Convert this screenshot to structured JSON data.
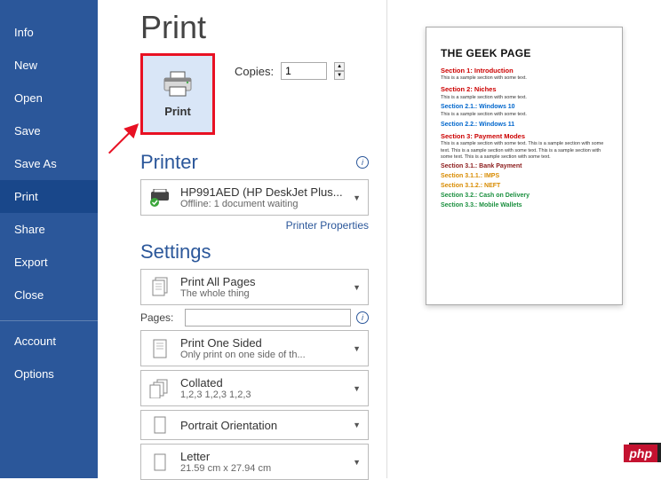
{
  "sidebar": {
    "items": [
      {
        "label": "Info"
      },
      {
        "label": "New"
      },
      {
        "label": "Open"
      },
      {
        "label": "Save"
      },
      {
        "label": "Save As"
      },
      {
        "label": "Print"
      },
      {
        "label": "Share"
      },
      {
        "label": "Export"
      },
      {
        "label": "Close"
      }
    ],
    "bottom": [
      {
        "label": "Account"
      },
      {
        "label": "Options"
      }
    ]
  },
  "page": {
    "title": "Print"
  },
  "print_button": {
    "label": "Print"
  },
  "copies": {
    "label": "Copies:",
    "value": "1"
  },
  "printer_section": {
    "heading": "Printer"
  },
  "printer_selector": {
    "name": "HP991AED (HP DeskJet Plus...",
    "status": "Offline: 1 document waiting"
  },
  "printer_properties": "Printer Properties",
  "settings_section": {
    "heading": "Settings"
  },
  "settings": {
    "print_all": {
      "line1": "Print All Pages",
      "line2": "The whole thing"
    },
    "pages_label": "Pages:",
    "one_sided": {
      "line1": "Print One Sided",
      "line2": "Only print on one side of th..."
    },
    "collated": {
      "line1": "Collated",
      "line2": "1,2,3    1,2,3    1,2,3"
    },
    "orientation": {
      "line1": "Portrait Orientation"
    },
    "paper": {
      "line1": "Letter",
      "line2": "21.59 cm x 27.94 cm"
    }
  },
  "preview": {
    "title": "THE GEEK PAGE",
    "sec1": "Section 1: Introduction",
    "body": "This is a sample section with some text.",
    "sec2": "Section 2: Niches",
    "sub21": "Section 2.1.: Windows 10",
    "sub22": "Section 2.2.: Windows 11",
    "sec3": "Section 3: Payment Modes",
    "body3": "This is a sample section with some text. This is a sample section with some text. This is a sample section with some text. This is a sample section with some text. This is a sample section with some text.",
    "sub31": "Section 3.1.: Bank Payment",
    "sub311": "Section 3.1.1.: IMPS",
    "sub312": "Section 3.1.2.: NEFT",
    "sub32": "Section 3.2.: Cash on Delivery",
    "sub33": "Section 3.3.: Mobile Wallets"
  },
  "badge": {
    "text": "php"
  }
}
